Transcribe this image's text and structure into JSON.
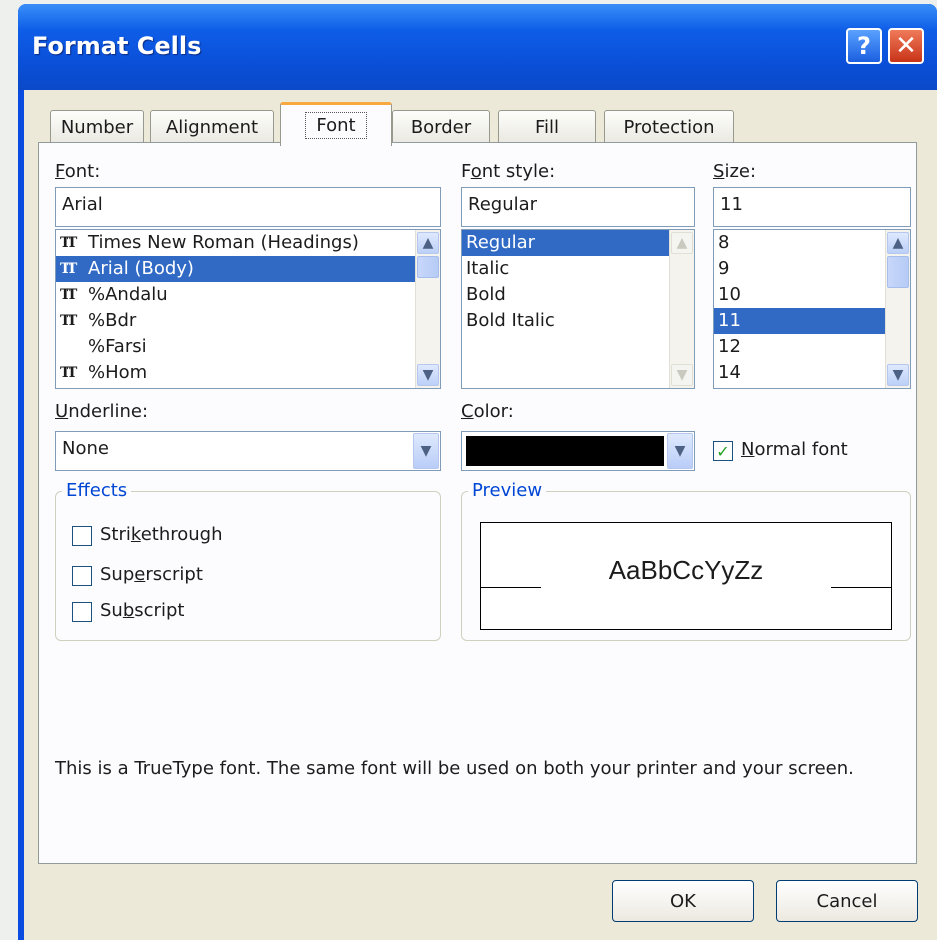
{
  "window": {
    "title": "Format Cells"
  },
  "tabs": [
    {
      "label": "Number"
    },
    {
      "label": "Alignment"
    },
    {
      "label": "Font",
      "active": true
    },
    {
      "label": "Border"
    },
    {
      "label": "Fill"
    },
    {
      "label": "Protection"
    }
  ],
  "font": {
    "label": "Font:",
    "value": "Arial",
    "items": [
      {
        "label": "Times New Roman (Headings)",
        "icon": "truetype-icon",
        "selected": false
      },
      {
        "label": "Arial (Body)",
        "icon": "truetype-icon",
        "selected": true
      },
      {
        "label": "%Andalu",
        "icon": "truetype-icon",
        "selected": false
      },
      {
        "label": "%Bdr",
        "icon": "truetype-icon",
        "selected": false
      },
      {
        "label": "%Farsi",
        "icon": "",
        "selected": false
      },
      {
        "label": "%Hom",
        "icon": "truetype-icon",
        "selected": false
      }
    ]
  },
  "font_style": {
    "label": "Font style:",
    "value": "Regular",
    "items": [
      {
        "label": "Regular",
        "selected": true
      },
      {
        "label": "Italic",
        "selected": false
      },
      {
        "label": "Bold",
        "selected": false
      },
      {
        "label": "Bold Italic",
        "selected": false
      }
    ]
  },
  "size": {
    "label": "Size:",
    "value": "11",
    "items": [
      {
        "label": "8",
        "selected": false
      },
      {
        "label": "9",
        "selected": false
      },
      {
        "label": "10",
        "selected": false
      },
      {
        "label": "11",
        "selected": true
      },
      {
        "label": "12",
        "selected": false
      },
      {
        "label": "14",
        "selected": false
      }
    ]
  },
  "underline": {
    "label": "Underline:",
    "value": "None"
  },
  "color": {
    "label": "Color:",
    "value": "#000000"
  },
  "normal_font": {
    "label": "Normal font",
    "checked": true
  },
  "effects": {
    "legend": "Effects",
    "items": [
      {
        "label": "Strikethrough",
        "checked": false
      },
      {
        "label": "Superscript",
        "checked": false
      },
      {
        "label": "Subscript",
        "checked": false
      }
    ]
  },
  "preview": {
    "legend": "Preview",
    "sample": "AaBbCcYyZz"
  },
  "info_text": "This is a TrueType font.  The same font will be used on both your printer and your screen.",
  "buttons": {
    "ok": "OK",
    "cancel": "Cancel"
  },
  "colors": {
    "titlebar": "#0a4fd8",
    "selection": "#316ac5",
    "dialog_bg": "#ece9d8",
    "group_text": "#0046d5"
  }
}
